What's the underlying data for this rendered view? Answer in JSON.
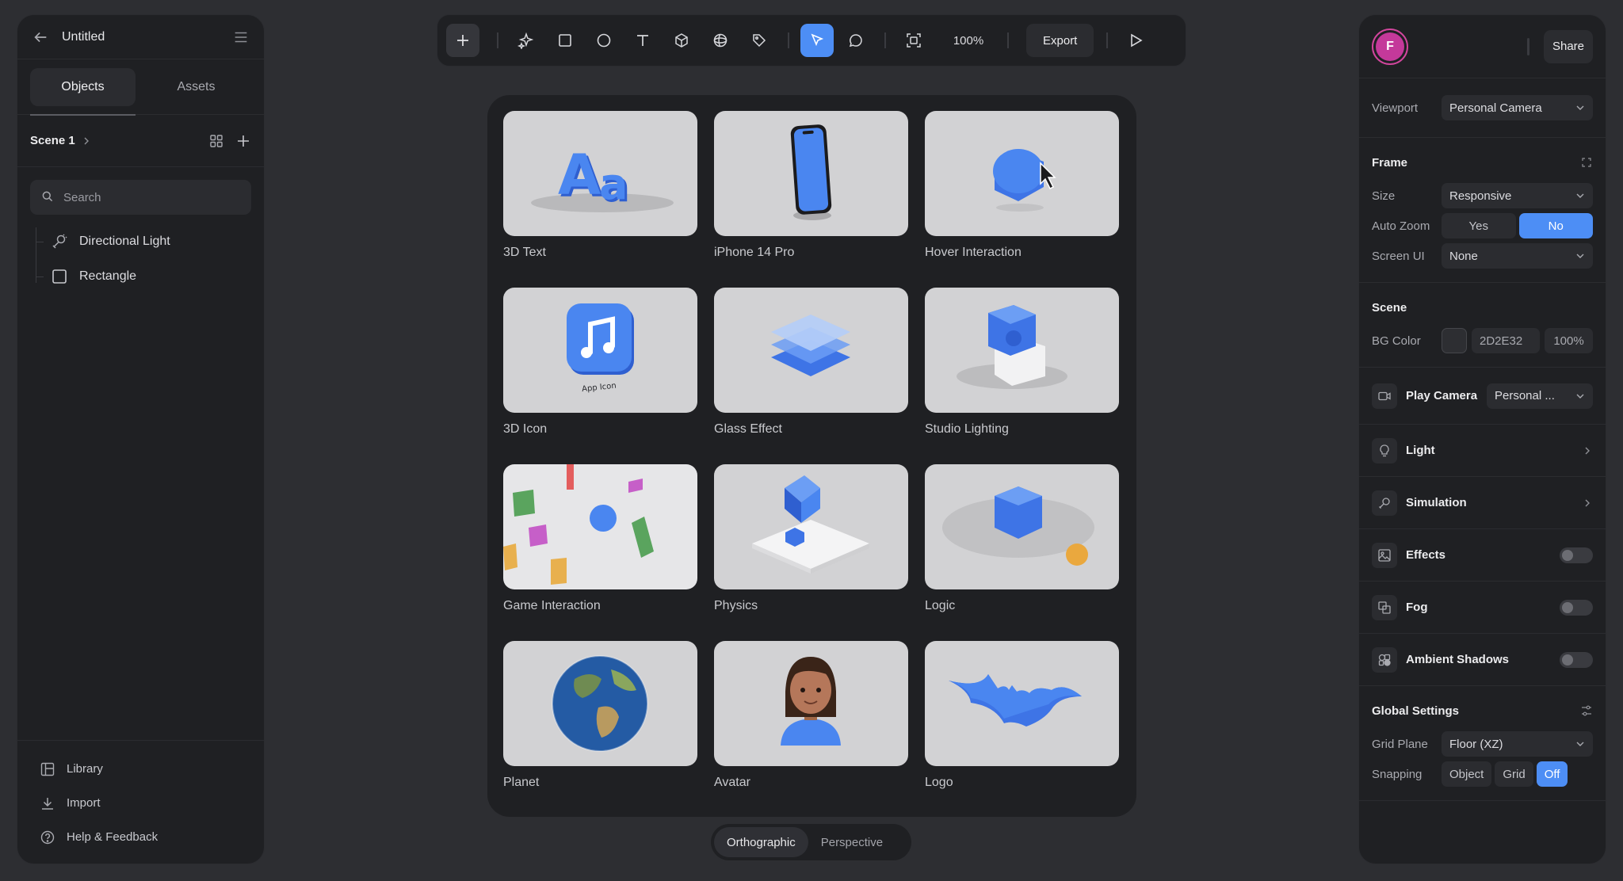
{
  "left_panel": {
    "title": "Untitled",
    "tabs": [
      {
        "label": "Objects"
      },
      {
        "label": "Assets"
      }
    ],
    "scene_name": "Scene 1",
    "search_placeholder": "Search",
    "tree": [
      {
        "label": "Directional Light",
        "icon": "light-icon"
      },
      {
        "label": "Rectangle",
        "icon": "rectangle-icon"
      }
    ],
    "footer": [
      {
        "label": "Library"
      },
      {
        "label": "Import"
      },
      {
        "label": "Help & Feedback"
      }
    ]
  },
  "toolbar": {
    "zoom": "100%",
    "export_label": "Export",
    "tools": [
      "add-icon",
      "ai-sparkle-icon",
      "rectangle-icon",
      "ellipse-icon",
      "text-icon",
      "cube-icon",
      "sphere-icon",
      "tag-icon",
      "pointer-icon",
      "comment-icon",
      "frame-icon",
      "play-icon"
    ],
    "accent": "#4d8ef5"
  },
  "gallery": {
    "items": [
      {
        "label": "3D Text"
      },
      {
        "label": "iPhone 14 Pro"
      },
      {
        "label": "Hover Interaction"
      },
      {
        "label": "3D Icon",
        "sub": "App Icon"
      },
      {
        "label": "Glass Effect"
      },
      {
        "label": "Studio Lighting"
      },
      {
        "label": "Game Interaction"
      },
      {
        "label": "Physics"
      },
      {
        "label": "Logic"
      },
      {
        "label": "Planet"
      },
      {
        "label": "Avatar"
      },
      {
        "label": "Logo"
      }
    ]
  },
  "view_toggle": {
    "orthographic": "Orthographic",
    "perspective": "Perspective",
    "active": "Orthographic"
  },
  "right_panel": {
    "avatar_initial": "F",
    "share_label": "Share",
    "viewport": {
      "label": "Viewport",
      "value": "Personal Camera"
    },
    "frame": {
      "title": "Frame",
      "size": {
        "label": "Size",
        "value": "Responsive"
      },
      "auto_zoom": {
        "label": "Auto Zoom",
        "yes": "Yes",
        "no": "No",
        "selected": "No"
      },
      "screen_ui": {
        "label": "Screen UI",
        "value": "None"
      }
    },
    "scene": {
      "title": "Scene",
      "bg_color": {
        "label": "BG Color",
        "hex": "2D2E32",
        "opacity": "100%",
        "swatch": "#2d2e32"
      }
    },
    "play_camera": {
      "label": "Play Camera",
      "value": "Personal ..."
    },
    "features": [
      {
        "label": "Light",
        "type": "chevron",
        "icon": "bulb-icon"
      },
      {
        "label": "Simulation",
        "type": "chevron",
        "icon": "simulation-icon"
      },
      {
        "label": "Effects",
        "type": "toggle",
        "icon": "image-icon",
        "on": false
      },
      {
        "label": "Fog",
        "type": "toggle",
        "icon": "fog-icon",
        "on": false
      },
      {
        "label": "Ambient Shadows",
        "type": "toggle",
        "icon": "shadows-icon",
        "on": false
      }
    ],
    "global": {
      "title": "Global Settings",
      "grid_plane": {
        "label": "Grid Plane",
        "value": "Floor (XZ)"
      },
      "snapping": {
        "label": "Snapping",
        "options": [
          "Object",
          "Grid",
          "Off"
        ],
        "selected": "Off"
      }
    }
  }
}
